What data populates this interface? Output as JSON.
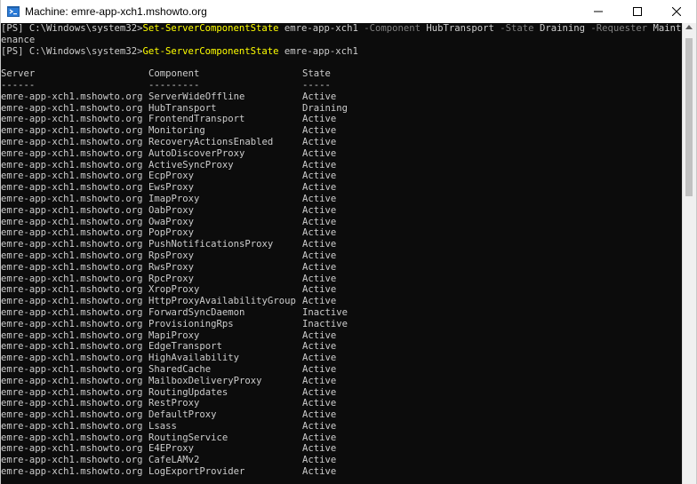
{
  "window": {
    "title": "Machine: emre-app-xch1.mshowto.org",
    "icon": "powershell-remote-icon",
    "controls": [
      "minimize-icon",
      "maximize-icon",
      "close-icon"
    ]
  },
  "console": {
    "colors": {
      "background": "#0c0c0c",
      "text": "#cccccc",
      "command": "#ffff00",
      "parameter": "#808080"
    },
    "line1": {
      "prompt": "[PS] C:\\Windows\\system32>",
      "cmdlet": "Set-ServerComponentState",
      "server": " emre-app-xch1 ",
      "p1": "-Component",
      "v1": " HubTransport ",
      "p2": "-State",
      "v2": " Draining ",
      "p3": "-Requester",
      "v3": " Maint"
    },
    "line1_wrap": "enance",
    "line2": {
      "prompt": "[PS] C:\\Windows\\system32>",
      "cmdlet": "Get-ServerComponentState",
      "server": " emre-app-xch1"
    },
    "headers": {
      "server": "Server",
      "component": "Component",
      "state": "State"
    },
    "separators": {
      "server": "------",
      "component": "---------",
      "state": "-----"
    },
    "rows": [
      {
        "server": "emre-app-xch1.mshowto.org",
        "component": "ServerWideOffline",
        "state": "Active"
      },
      {
        "server": "emre-app-xch1.mshowto.org",
        "component": "HubTransport",
        "state": "Draining"
      },
      {
        "server": "emre-app-xch1.mshowto.org",
        "component": "FrontendTransport",
        "state": "Active"
      },
      {
        "server": "emre-app-xch1.mshowto.org",
        "component": "Monitoring",
        "state": "Active"
      },
      {
        "server": "emre-app-xch1.mshowto.org",
        "component": "RecoveryActionsEnabled",
        "state": "Active"
      },
      {
        "server": "emre-app-xch1.mshowto.org",
        "component": "AutoDiscoverProxy",
        "state": "Active"
      },
      {
        "server": "emre-app-xch1.mshowto.org",
        "component": "ActiveSyncProxy",
        "state": "Active"
      },
      {
        "server": "emre-app-xch1.mshowto.org",
        "component": "EcpProxy",
        "state": "Active"
      },
      {
        "server": "emre-app-xch1.mshowto.org",
        "component": "EwsProxy",
        "state": "Active"
      },
      {
        "server": "emre-app-xch1.mshowto.org",
        "component": "ImapProxy",
        "state": "Active"
      },
      {
        "server": "emre-app-xch1.mshowto.org",
        "component": "OabProxy",
        "state": "Active"
      },
      {
        "server": "emre-app-xch1.mshowto.org",
        "component": "OwaProxy",
        "state": "Active"
      },
      {
        "server": "emre-app-xch1.mshowto.org",
        "component": "PopProxy",
        "state": "Active"
      },
      {
        "server": "emre-app-xch1.mshowto.org",
        "component": "PushNotificationsProxy",
        "state": "Active"
      },
      {
        "server": "emre-app-xch1.mshowto.org",
        "component": "RpsProxy",
        "state": "Active"
      },
      {
        "server": "emre-app-xch1.mshowto.org",
        "component": "RwsProxy",
        "state": "Active"
      },
      {
        "server": "emre-app-xch1.mshowto.org",
        "component": "RpcProxy",
        "state": "Active"
      },
      {
        "server": "emre-app-xch1.mshowto.org",
        "component": "XropProxy",
        "state": "Active"
      },
      {
        "server": "emre-app-xch1.mshowto.org",
        "component": "HttpProxyAvailabilityGroup",
        "state": "Active"
      },
      {
        "server": "emre-app-xch1.mshowto.org",
        "component": "ForwardSyncDaemon",
        "state": "Inactive"
      },
      {
        "server": "emre-app-xch1.mshowto.org",
        "component": "ProvisioningRps",
        "state": "Inactive"
      },
      {
        "server": "emre-app-xch1.mshowto.org",
        "component": "MapiProxy",
        "state": "Active"
      },
      {
        "server": "emre-app-xch1.mshowto.org",
        "component": "EdgeTransport",
        "state": "Active"
      },
      {
        "server": "emre-app-xch1.mshowto.org",
        "component": "HighAvailability",
        "state": "Active"
      },
      {
        "server": "emre-app-xch1.mshowto.org",
        "component": "SharedCache",
        "state": "Active"
      },
      {
        "server": "emre-app-xch1.mshowto.org",
        "component": "MailboxDeliveryProxy",
        "state": "Active"
      },
      {
        "server": "emre-app-xch1.mshowto.org",
        "component": "RoutingUpdates",
        "state": "Active"
      },
      {
        "server": "emre-app-xch1.mshowto.org",
        "component": "RestProxy",
        "state": "Active"
      },
      {
        "server": "emre-app-xch1.mshowto.org",
        "component": "DefaultProxy",
        "state": "Active"
      },
      {
        "server": "emre-app-xch1.mshowto.org",
        "component": "Lsass",
        "state": "Active"
      },
      {
        "server": "emre-app-xch1.mshowto.org",
        "component": "RoutingService",
        "state": "Active"
      },
      {
        "server": "emre-app-xch1.mshowto.org",
        "component": "E4EProxy",
        "state": "Active"
      },
      {
        "server": "emre-app-xch1.mshowto.org",
        "component": "CafeLAMv2",
        "state": "Active"
      },
      {
        "server": "emre-app-xch1.mshowto.org",
        "component": "LogExportProvider",
        "state": "Active"
      }
    ]
  }
}
